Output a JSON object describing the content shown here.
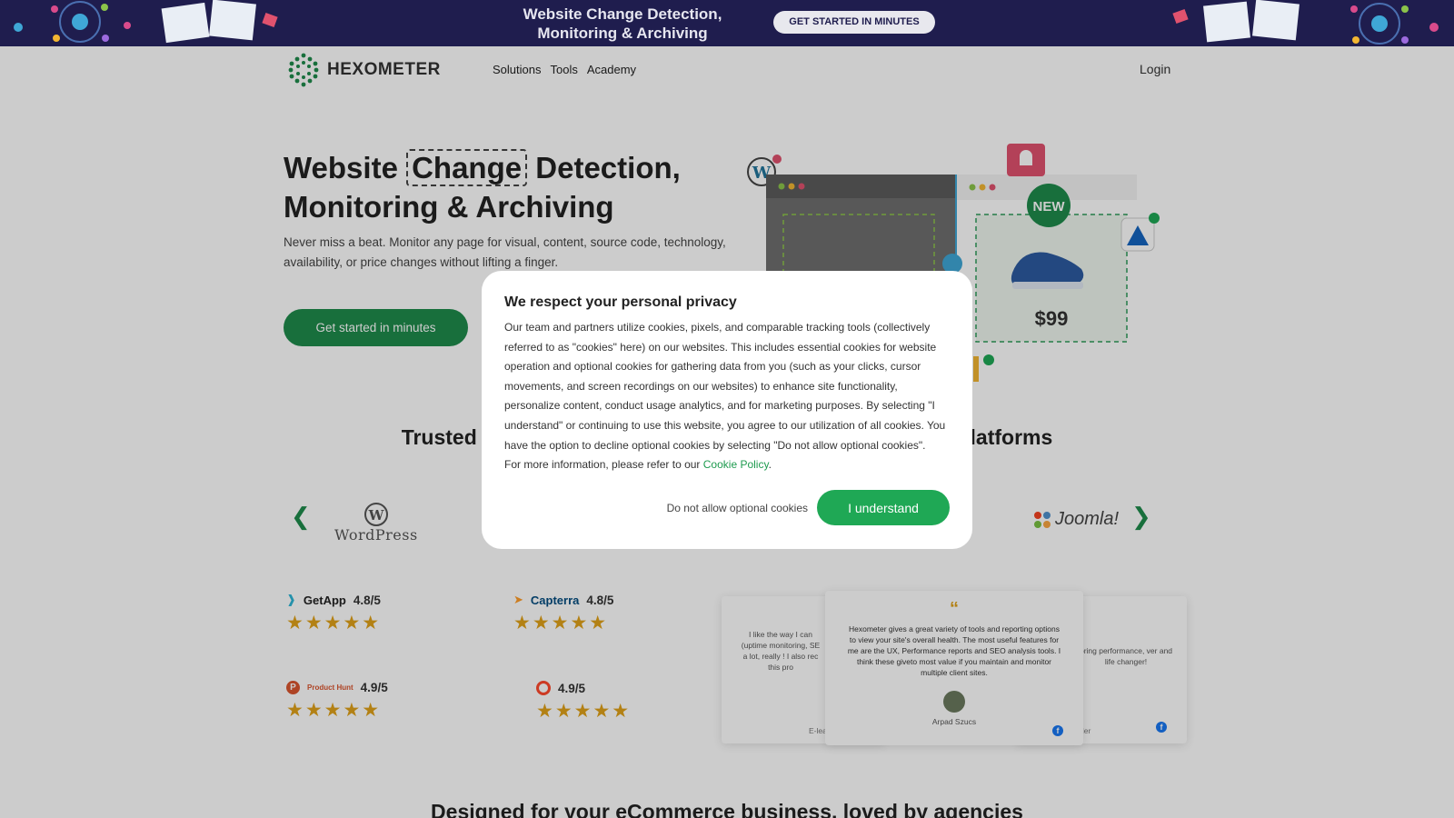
{
  "promo": {
    "title": "Website Change Detection, Monitoring & Archiving",
    "cta": "GET STARTED IN MINUTES"
  },
  "nav": {
    "brand": "HEXOMETER",
    "links": [
      "Solutions",
      "Tools",
      "Academy"
    ],
    "login": "Login"
  },
  "hero": {
    "title_pre": "Website ",
    "title_highlight": "Change",
    "title_post": " Detection, Monitoring & Archiving",
    "subtitle": "Never miss a beat. Monitor any page for visual, content, source code, technology, availability, or price changes without lifting a finger.",
    "cta": "Get started in minutes",
    "illustration": {
      "badge_new": "NEW",
      "price": "$99"
    }
  },
  "trusted": {
    "heading_left": "Trusted",
    "heading_right": "latforms",
    "logos": [
      "WordPress",
      "Joomla!"
    ]
  },
  "ratings": [
    {
      "brand": "GetApp",
      "score": "4.8/5",
      "stars": 5
    },
    {
      "brand": "Capterra",
      "score": "4.8/5",
      "stars": 5
    },
    {
      "brand": "Product Hunt",
      "score": "4.9/5",
      "stars": 5
    },
    {
      "brand": "G2",
      "score": "4.9/5",
      "stars": 5
    }
  ],
  "testimonials": {
    "left_fragment": "I like the way I can (uptime monitoring, SE a lot, really ! I also rec this pro",
    "left_author_fragment": "E-lea",
    "center_text": "Hexometer gives a great variety of tools and reporting options to view your site's overall health. The most useful features for me are the UX, Performance reports and SEO analysis tools. I think these giveto most value if you maintain and monitor multiple client sites.",
    "center_author": "Arpad Szucs",
    "right_fragment": "oring performance, ver and life changer!",
    "right_author_fragment": "der"
  },
  "bottom_heading": "Designed for your eCommerce business, loved by agencies",
  "cookie_modal": {
    "title": "We respect your personal privacy",
    "body": "Our team and partners utilize cookies, pixels, and comparable tracking tools (collectively referred to as \"cookies\" here) on our websites. This includes essential cookies for website operation and optional cookies for gathering data from you (such as your clicks, cursor movements, and screen recordings on our websites) to enhance site functionality, personalize content, conduct usage analytics, and for marketing purposes. By selecting \"I understand\" or continuing to use this website, you agree to our utilization of all cookies. You have the option to decline optional cookies by selecting \"Do not allow optional cookies\".",
    "more_info_prefix": "For more information, please refer to our ",
    "policy_link": "Cookie Policy",
    "more_info_suffix": ".",
    "decline_label": "Do not allow optional cookies",
    "accept_label": "I understand"
  },
  "colors": {
    "brand_green": "#1e8b4c",
    "accept_green": "#1fa855",
    "promo_bg": "#1f1d4e",
    "star": "#e0a21a"
  }
}
